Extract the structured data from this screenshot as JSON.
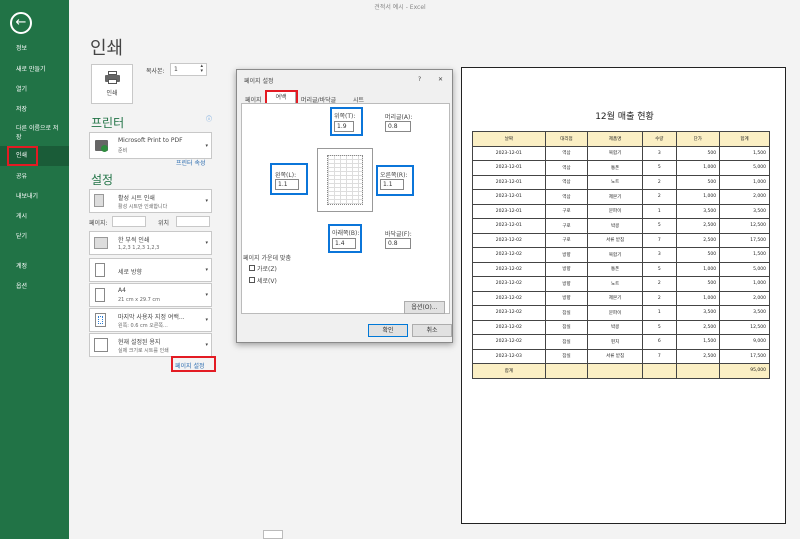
{
  "window": {
    "title": "견적서 예시 - Excel"
  },
  "sidebar": {
    "back_icon": "back-arrow-icon",
    "items": [
      {
        "label": "정보"
      },
      {
        "label": "새로 만들기"
      },
      {
        "label": "열기"
      },
      {
        "label": "저장"
      },
      {
        "label": "다른 이름으로 저장"
      },
      {
        "label": "인쇄"
      },
      {
        "label": "공유"
      },
      {
        "label": "내보내기"
      },
      {
        "label": "게시"
      },
      {
        "label": "닫기"
      },
      {
        "label": "계정"
      },
      {
        "label": "옵션"
      }
    ]
  },
  "print": {
    "heading": "인쇄",
    "print_button": "인쇄",
    "copies_label": "복사본:",
    "copies_value": "1",
    "printer_heading": "프린터",
    "printer_name": "Microsoft Print to PDF",
    "printer_status": "준비",
    "printer_props": "프린터 속성",
    "settings_heading": "설정",
    "s1_title": "활성 시트 인쇄",
    "s1_sub": "활성 시트만 인쇄합니다",
    "pages_label": "페이지:",
    "to_label": "위치",
    "s3_title": "한 부씩 인쇄",
    "s3_sub": "1,2,3    1,2,3    1,2,3",
    "s4_title": "세로 방향",
    "s5_title": "A4",
    "s5_sub": "21 cm x 29.7 cm",
    "s6_title": "마지막 사용자 지정 여백...",
    "s6_sub": "왼쪽:  0.6 cm    오른쪽...",
    "s7_title": "현재 설정된 용지",
    "s7_sub": "실제 크기로 시트를 인쇄",
    "page_setup_link": "페이지 설정"
  },
  "dialog": {
    "title": "페이지 설정",
    "help": "?",
    "close": "✕",
    "tabs": [
      "페이지",
      "여백",
      "머리글/바닥글",
      "시트"
    ],
    "top_label": "위쪽(T):",
    "top_value": "1.9",
    "header_label": "머리글(A):",
    "header_value": "0.8",
    "left_label": "왼쪽(L):",
    "left_value": "1.1",
    "right_label": "오른쪽(R):",
    "right_value": "1.1",
    "bottom_label": "아래쪽(B):",
    "bottom_value": "1.4",
    "footer_label": "바닥글(F):",
    "footer_value": "0.8",
    "center_label": "페이지 가운데 맞춤",
    "horizontal": "가로(Z)",
    "vertical": "세로(V)",
    "options": "옵션(O)...",
    "ok": "확인",
    "cancel": "취소"
  },
  "preview": {
    "title": "12월 매출 현황",
    "headers": [
      "날짜",
      "대리점",
      "제품명",
      "수량",
      "단가",
      "합계"
    ],
    "rows": [
      [
        "2023-12-01",
        "역삼",
        "복합기",
        "3",
        "500",
        "1,500"
      ],
      [
        "2023-12-01",
        "역삼",
        "통폰",
        "5",
        "1,000",
        "5,000"
      ],
      [
        "2023-12-01",
        "역삼",
        "노트",
        "2",
        "500",
        "1,000"
      ],
      [
        "2023-12-01",
        "역삼",
        "제본기",
        "2",
        "1,000",
        "2,000"
      ],
      [
        "2023-12-01",
        "구로",
        "문파이",
        "1",
        "3,500",
        "3,500"
      ],
      [
        "2023-12-01",
        "구로",
        "박콩",
        "5",
        "2,500",
        "12,500"
      ],
      [
        "2023-12-02",
        "구로",
        "서류 받침",
        "7",
        "2,500",
        "17,500"
      ],
      [
        "2023-12-02",
        "방향",
        "복합기",
        "3",
        "500",
        "1,500"
      ],
      [
        "2023-12-02",
        "방향",
        "통폰",
        "5",
        "1,000",
        "5,000"
      ],
      [
        "2023-12-02",
        "방향",
        "노트",
        "2",
        "500",
        "1,000"
      ],
      [
        "2023-12-02",
        "방향",
        "제본기",
        "2",
        "1,000",
        "2,000"
      ],
      [
        "2023-12-02",
        "잠실",
        "문파이",
        "1",
        "3,500",
        "3,500"
      ],
      [
        "2023-12-02",
        "잠실",
        "박콩",
        "5",
        "2,500",
        "12,500"
      ],
      [
        "2023-12-02",
        "잠실",
        "펀치",
        "6",
        "1,500",
        "9,000"
      ],
      [
        "2023-12-03",
        "잠실",
        "서류 받침",
        "7",
        "2,500",
        "17,500"
      ]
    ],
    "total_label": "합계",
    "total_value": "95,000"
  },
  "colors": {
    "excel_green": "#217346",
    "highlight_red": "#e31b23",
    "highlight_blue": "#0b75d9",
    "header_fill": "#fbefc4"
  }
}
